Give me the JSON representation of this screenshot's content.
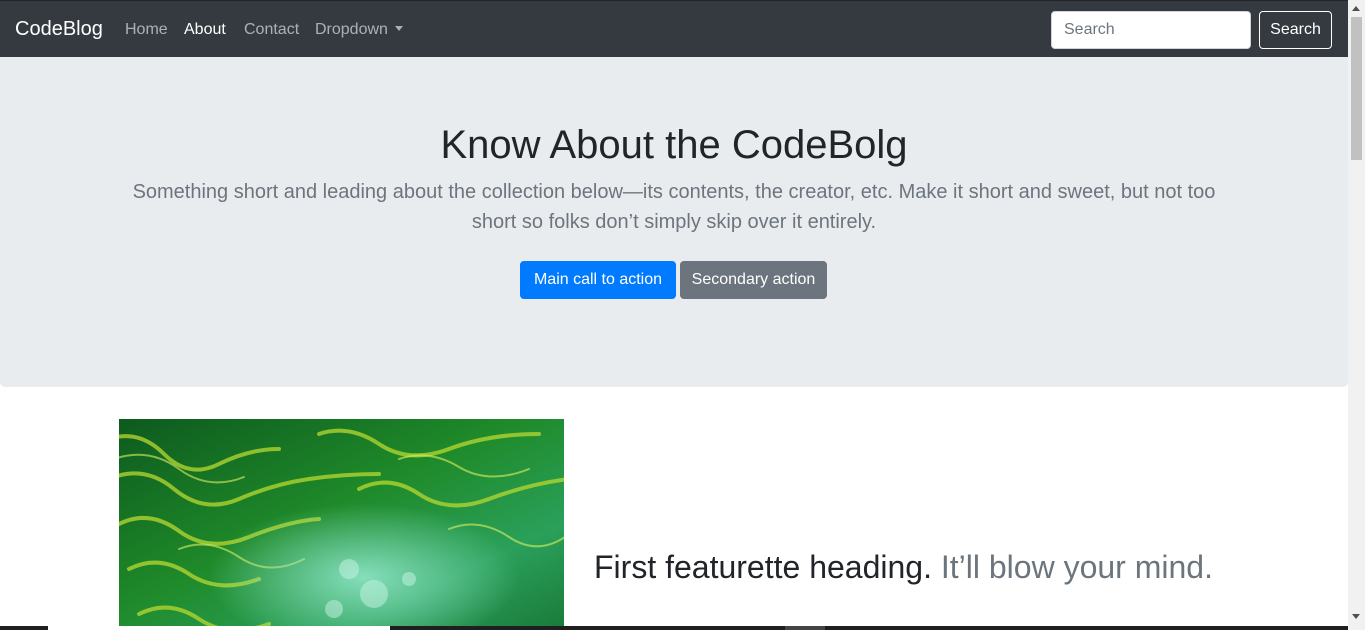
{
  "navbar": {
    "brand": "CodeBlog",
    "links": [
      {
        "label": "Home",
        "active": false
      },
      {
        "label": "About",
        "active": true
      },
      {
        "label": "Contact",
        "active": false
      },
      {
        "label": "Dropdown",
        "active": false
      }
    ],
    "search_placeholder": "Search",
    "search_button": "Search"
  },
  "jumbotron": {
    "title": "Know About the CodeBolg",
    "lead": "Something short and leading about the collection below—its contents, the creator, etc. Make it short and sweet, but not too short so folks don’t simply skip over it entirely.",
    "primary_button": "Main call to action",
    "secondary_button": "Secondary action"
  },
  "featurette": {
    "heading": "First featurette heading.",
    "heading_muted": "It’ll blow your mind."
  },
  "colors": {
    "navbar_bg": "#343a40",
    "jumbotron_bg": "#e9ecef",
    "primary": "#007bff",
    "secondary": "#6c757d"
  }
}
